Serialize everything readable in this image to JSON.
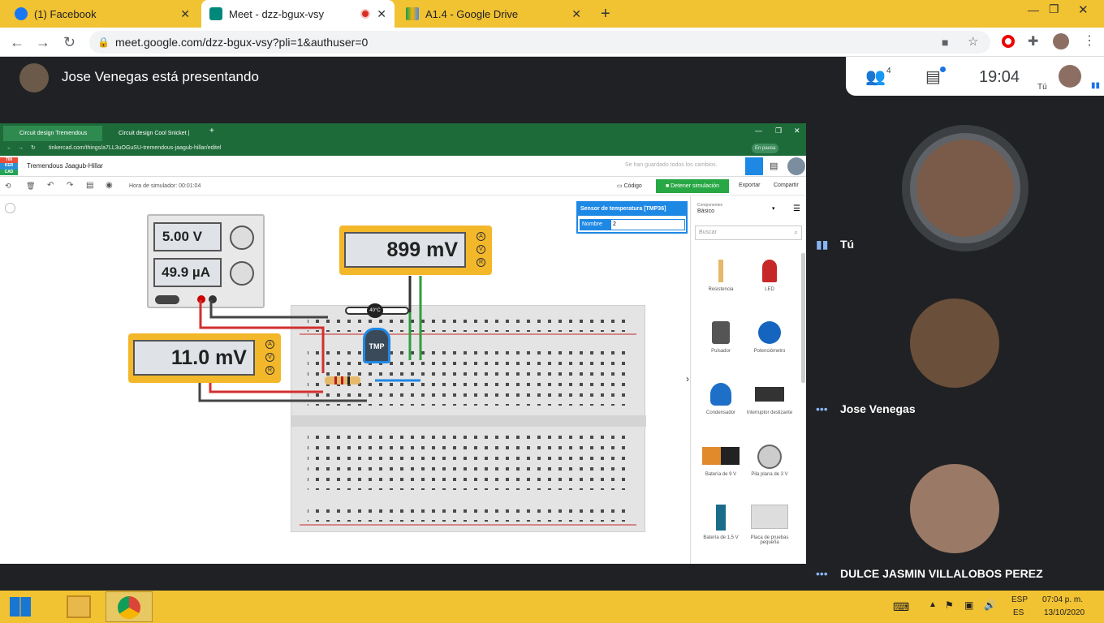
{
  "browser": {
    "tabs": [
      {
        "title": "(1) Facebook",
        "icon": "facebook-icon"
      },
      {
        "title": "Meet - dzz-bgux-vsy",
        "icon": "meet-icon"
      },
      {
        "title": "A1.4 - Google Drive",
        "icon": "drive-icon"
      }
    ],
    "url": "meet.google.com/dzz-bgux-vsy?pli=1&authuser=0"
  },
  "meet": {
    "presenter_text": "Jose Venegas está presentando",
    "participant_count": "4",
    "time": "19:04",
    "self_label": "Tú",
    "participants": [
      "Tú",
      "Jose Venegas",
      "DULCE JASMIN VILLALOBOS PEREZ"
    ]
  },
  "tinkercad": {
    "inner_tabs": [
      "Circuit design Tremendous Jaag...",
      "Circuit design Cool Snicket | Tink..."
    ],
    "inner_url": "tinkercad.com/things/a7LL3uOGuSU-tremendous-jaagub-hillar/editel",
    "in_pause": "En pausa",
    "logo": [
      "TIN",
      "KER",
      "CAD"
    ],
    "design_name": "Tremendous Jaagub-Hillar",
    "saved_msg": "Se han guardado todos los cambios.",
    "sim_time": "Hora de simulador: 00:01:04",
    "code_btn": "Código",
    "stop_btn": "Detener simulación",
    "export_btn": "Exportar",
    "share_btn": "Compartir",
    "power_supply": {
      "voltage": "5.00 V",
      "current": "49.9 µA"
    },
    "meter1": "899 mV",
    "meter2": "11.0 mV",
    "tmp_label": "TMP",
    "temp_reading": "40°C",
    "props_title": "Sensor de temperatura [TMP36]",
    "props_name_label": "Nombre",
    "props_name_value": "2",
    "components_label": "Componentes",
    "components_select": "Básico",
    "search_placeholder": "Buscar",
    "components": [
      "Resistencia",
      "LED",
      "Pulsador",
      "Potenciómetro",
      "Condensador",
      "Interruptor deslizante",
      "Batería de 9 V",
      "Pila plana de 3 V",
      "Batería de 1,5 V",
      "Placa de pruebas pequeña"
    ]
  },
  "taskbar": {
    "lang1": "ESP",
    "lang2": "ES",
    "time": "07:04 p. m.",
    "date": "13/10/2020"
  },
  "colors": {
    "taskbar": "#f1c232",
    "meet_bg": "#202124",
    "tinkercad_green": "#1e6b3a",
    "meter": "#f3b72a"
  }
}
